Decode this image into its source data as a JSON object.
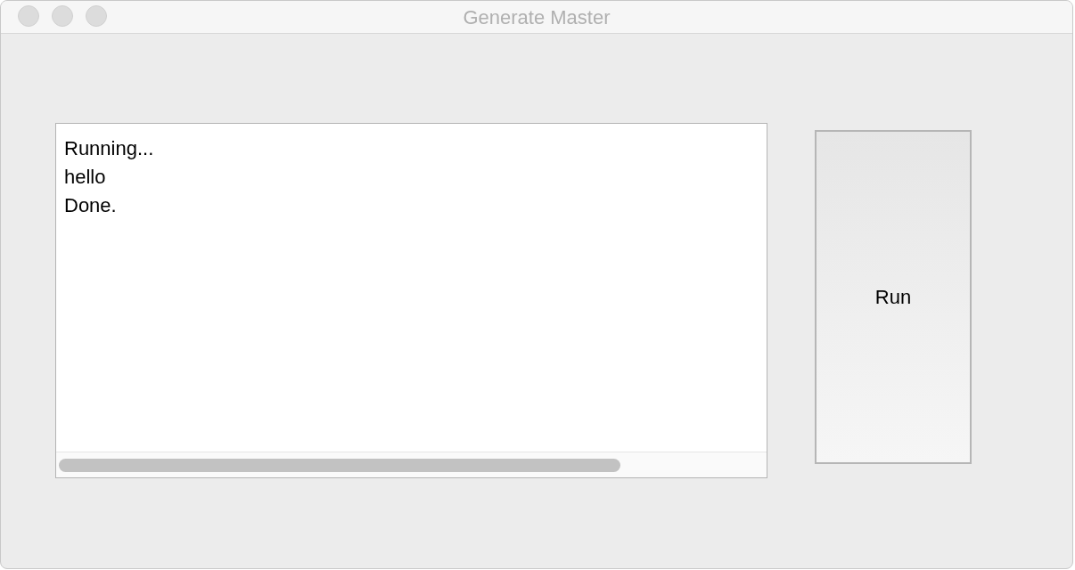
{
  "window": {
    "title": "Generate Master"
  },
  "output": {
    "lines": [
      "Running...",
      "hello",
      "Done."
    ]
  },
  "run_button": {
    "label": "Run"
  }
}
